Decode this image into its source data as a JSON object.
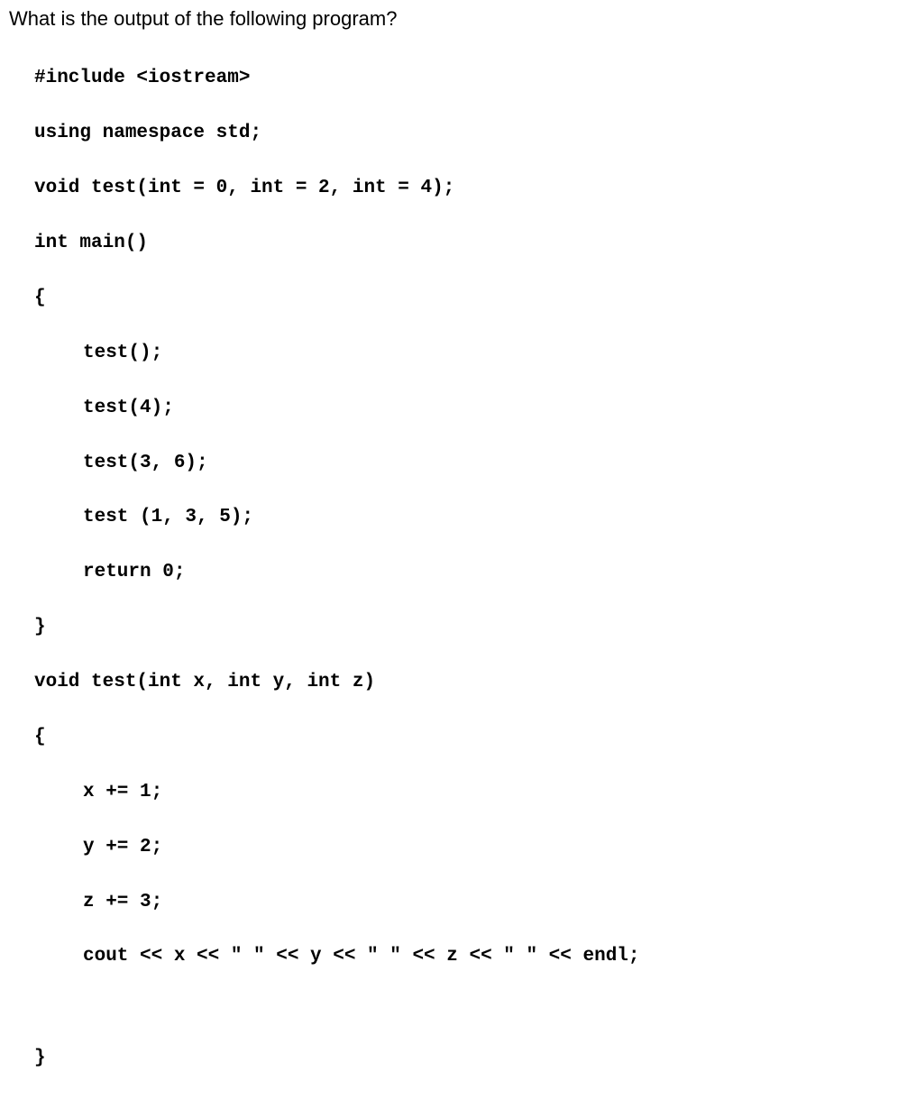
{
  "question": "What is the output of the following program?",
  "code": {
    "line1": "#include <iostream>",
    "line2": "using namespace std;",
    "line3": "void test(int = 0, int = 2, int = 4);",
    "line4": "int main()",
    "line5": "{",
    "line6": "test();",
    "line7": "test(4);",
    "line8": "test(3, 6);",
    "line9": "test (1, 3, 5);",
    "line10": "return 0;",
    "line11": "}",
    "line12": "void test(int x, int y, int z)",
    "line13": "{",
    "line14": "x += 1;",
    "line15": "y += 2;",
    "line16": "z += 3;",
    "line17": "cout << x << \" \" << y << \" \" << z << \" \" << endl;",
    "line18": "}"
  }
}
